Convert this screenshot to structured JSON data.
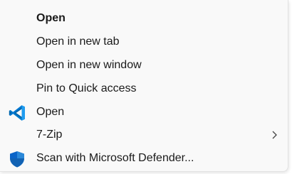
{
  "context_menu": {
    "items": [
      {
        "label": "Open",
        "bold": true,
        "icon": ""
      },
      {
        "label": "Open in new tab",
        "icon": ""
      },
      {
        "label": "Open in new window",
        "icon": ""
      },
      {
        "label": "Pin to Quick access",
        "icon": ""
      },
      {
        "label": "Open",
        "icon": "vscode-icon"
      },
      {
        "label": "7-Zip",
        "icon": "",
        "submenu": true,
        "submenu_icon": "chevron-right-icon"
      },
      {
        "label": "Scan with Microsoft Defender...",
        "icon": "defender-shield-icon"
      }
    ]
  },
  "colors": {
    "menu_background": "#f9f9f9",
    "text": "#1a1a1a",
    "vscode_blue": "#0078d4",
    "defender_blue": "#0a64c8"
  }
}
